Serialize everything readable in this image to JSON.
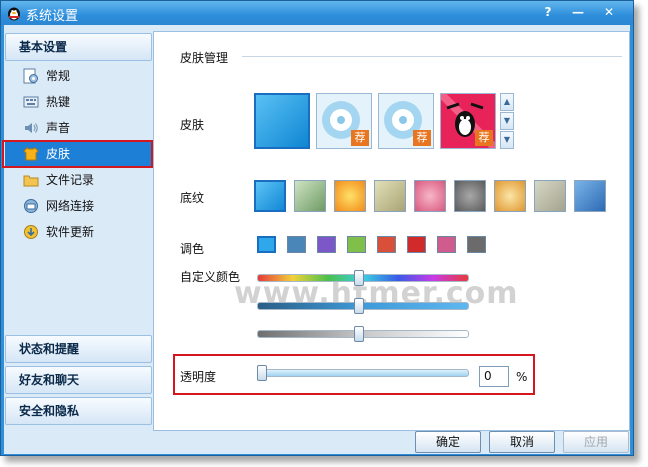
{
  "window": {
    "title": "系统设置",
    "help_glyph": "?",
    "minimize_glyph": "—",
    "close_glyph": "✕"
  },
  "sidebar": {
    "header_basic": "基本设置",
    "items": [
      {
        "label": "常规",
        "icon": "general-settings-icon"
      },
      {
        "label": "热键",
        "icon": "hotkey-icon"
      },
      {
        "label": "声音",
        "icon": "sound-icon"
      },
      {
        "label": "皮肤",
        "icon": "skin-icon",
        "active": true
      },
      {
        "label": "文件记录",
        "icon": "folder-icon"
      },
      {
        "label": "网络连接",
        "icon": "network-icon"
      },
      {
        "label": "软件更新",
        "icon": "update-icon"
      }
    ],
    "header_status": "状态和提醒",
    "header_friends": "好友和聊天",
    "header_security": "安全和隐私"
  },
  "main": {
    "skin_manage_title": "皮肤管理",
    "skin_label": "皮肤",
    "recommend_badge": "荐",
    "texture_label": "底纹",
    "tone_label": "调色",
    "custom_color_label": "自定义颜色",
    "transparency_label": "透明度",
    "transparency_value": "0",
    "transparency_unit": "%",
    "transparency_percent": 0,
    "slider_levels": {
      "hue": 0.48,
      "saturation": 0.48,
      "brightness": 0.48
    },
    "tone_colors": [
      "#2ea8ea",
      "#4a86b8",
      "#7c57c7",
      "#7fbf4a",
      "#d9503a",
      "#d12a2a",
      "#d05c8e",
      "#6b6b6b"
    ]
  },
  "watermark": "www.htmer.com",
  "buttons": {
    "ok": "确定",
    "cancel": "取消",
    "apply": "应用"
  }
}
